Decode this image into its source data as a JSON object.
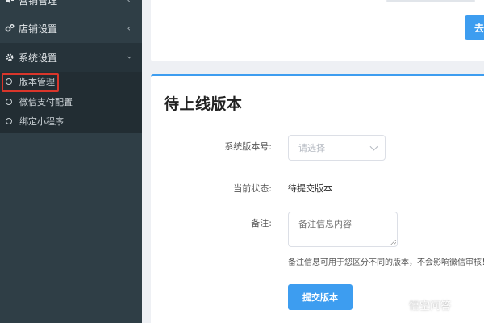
{
  "sidebar": {
    "items": [
      {
        "label": "营销管理",
        "icon": "marketing-icon"
      },
      {
        "label": "店铺设置",
        "icon": "store-settings-icon"
      },
      {
        "label": "系统设置",
        "icon": "gear-icon",
        "expanded": true
      }
    ],
    "submenu": [
      {
        "label": "版本管理",
        "active": true
      },
      {
        "label": "微信支付配置"
      },
      {
        "label": "绑定小程序"
      }
    ]
  },
  "top_card": {
    "button_label": "去提"
  },
  "main": {
    "title": "待上线版本",
    "form": {
      "version_label": "系统版本号:",
      "version_placeholder": "请选择",
      "status_label": "当前状态:",
      "status_value": "待提交版本",
      "remark_label": "备注:",
      "remark_placeholder": "备注信息内容",
      "hint": "备注信息可用于您区分不同的版本，不会影响微信审核！",
      "submit_label": "提交版本"
    }
  },
  "watermark": {
    "text": "悟空问答",
    "icon": "wukong-logo-icon"
  },
  "colors": {
    "sidebar_bg": "#2f3e46",
    "accent": "#3d9df0",
    "highlight": "#d9362b"
  }
}
